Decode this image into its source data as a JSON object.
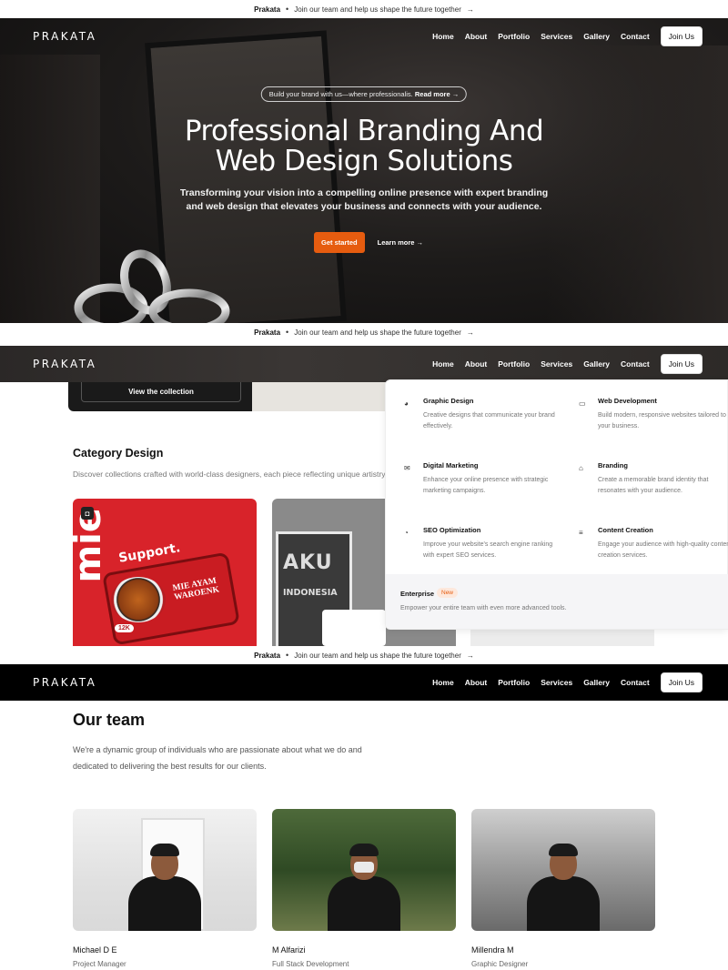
{
  "announcement": {
    "brand": "Prakata",
    "separator": "•",
    "text": "Join our team and help us shape the future together",
    "arrow": "→"
  },
  "nav": {
    "logo": "PRAKATA",
    "links": [
      "Home",
      "About",
      "Portfolio",
      "Services",
      "Gallery",
      "Contact"
    ],
    "join_label": "Join Us"
  },
  "hero": {
    "pill_text": "Build your brand with us—where professionalis.",
    "pill_link": "Read more →",
    "title_line1": "Professional Branding And",
    "title_line2": "Web Design Solutions",
    "subtitle": "Transforming your vision into a compelling online presence with expert branding and web design that elevates your business and connects with your audience.",
    "cta_primary": "Get started",
    "cta_secondary": "Learn more →"
  },
  "collection": {
    "view_label": "View the collection"
  },
  "category": {
    "title": "Category Design",
    "description": "Discover collections crafted with world-class designers, each piece reflecting unique artistry a",
    "card1": {
      "support": "Support.",
      "mie": "MIE AYAM WAROENK",
      "big": "mie",
      "badge": "12K"
    },
    "card2": {
      "aku": "AKU",
      "indo": "INDONESIA"
    }
  },
  "services_menu": {
    "items": [
      {
        "title": "Graphic Design",
        "desc": "Creative designs that communicate your brand effectively.",
        "icon": "palette-icon"
      },
      {
        "title": "Web Development",
        "desc": "Build modern, responsive websites tailored to your business.",
        "icon": "monitor-icon"
      },
      {
        "title": "Digital Marketing",
        "desc": "Enhance your online presence with strategic marketing campaigns.",
        "icon": "mail-icon"
      },
      {
        "title": "Branding",
        "desc": "Create a memorable brand identity that resonates with your audience.",
        "icon": "store-icon"
      },
      {
        "title": "SEO Optimization",
        "desc": "Improve your website's search engine ranking with expert SEO services.",
        "icon": "pie-icon"
      },
      {
        "title": "Content Creation",
        "desc": "Engage your audience with high-quality content creation services.",
        "icon": "content-icon"
      }
    ],
    "enterprise": {
      "title": "Enterprise",
      "badge": "New",
      "desc": "Empower your entire team with even more advanced tools."
    }
  },
  "team": {
    "title": "Our team",
    "description": "We're a dynamic group of individuals who are passionate about what we do and dedicated to delivering the best results for our clients.",
    "members": [
      {
        "name": "Michael D E",
        "role": "Project Manager"
      },
      {
        "name": "M Alfarizi",
        "role": "Full Stack Development"
      },
      {
        "name": "Millendra M",
        "role": "Graphic Designer"
      }
    ]
  },
  "colors": {
    "accent": "#e65c0f",
    "dark": "#111111"
  }
}
